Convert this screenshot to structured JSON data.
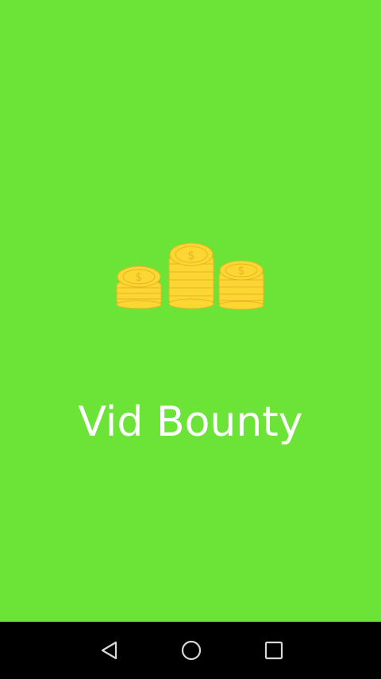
{
  "app": {
    "title": "Vid Bounty"
  },
  "colors": {
    "background": "#6be337",
    "title": "#ffffff",
    "coin_fill": "#fcd633",
    "coin_stroke": "#e8b522",
    "nav_background": "#000000",
    "nav_icon": "#d8d8d8"
  },
  "logo": {
    "icon": "coin-stacks-icon",
    "symbol": "$"
  },
  "nav": {
    "back_icon": "back-triangle-icon",
    "home_icon": "home-circle-icon",
    "recent_icon": "recent-apps-square-icon"
  }
}
